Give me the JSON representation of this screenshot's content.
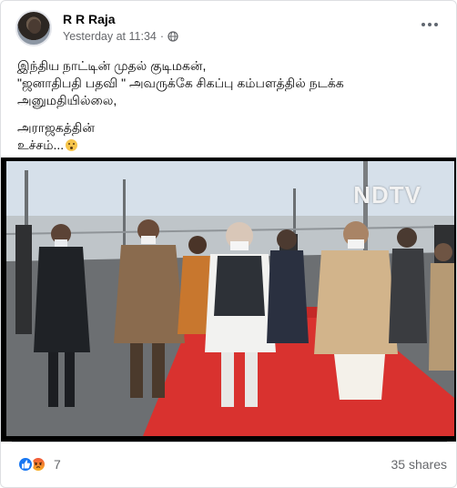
{
  "post": {
    "author": "R R Raja",
    "timestamp": "Yesterday at 11:34",
    "separator": "·",
    "privacy_icon": "globe-icon",
    "text_lines": [
      "இந்திய நாட்டின் முதல் குடிமகன்,",
      "\"ஜனாதிபதி பதவி \" அவருக்கே சிகப்பு கம்பளத்தில் நடக்க",
      "அனுமதியில்லை,",
      "",
      "அராஜகத்தின்",
      "உச்சம்..."
    ],
    "text_emoji": "hushed-face-emoji"
  },
  "video": {
    "channel_logo": "NDTV"
  },
  "footer": {
    "reaction_icons": [
      "like-icon",
      "angry-icon"
    ],
    "reaction_count": "7",
    "shares": "35 shares"
  },
  "colors": {
    "accent": "#1877f2",
    "secondary_text": "#65676b",
    "carpet": "#d9322f"
  }
}
